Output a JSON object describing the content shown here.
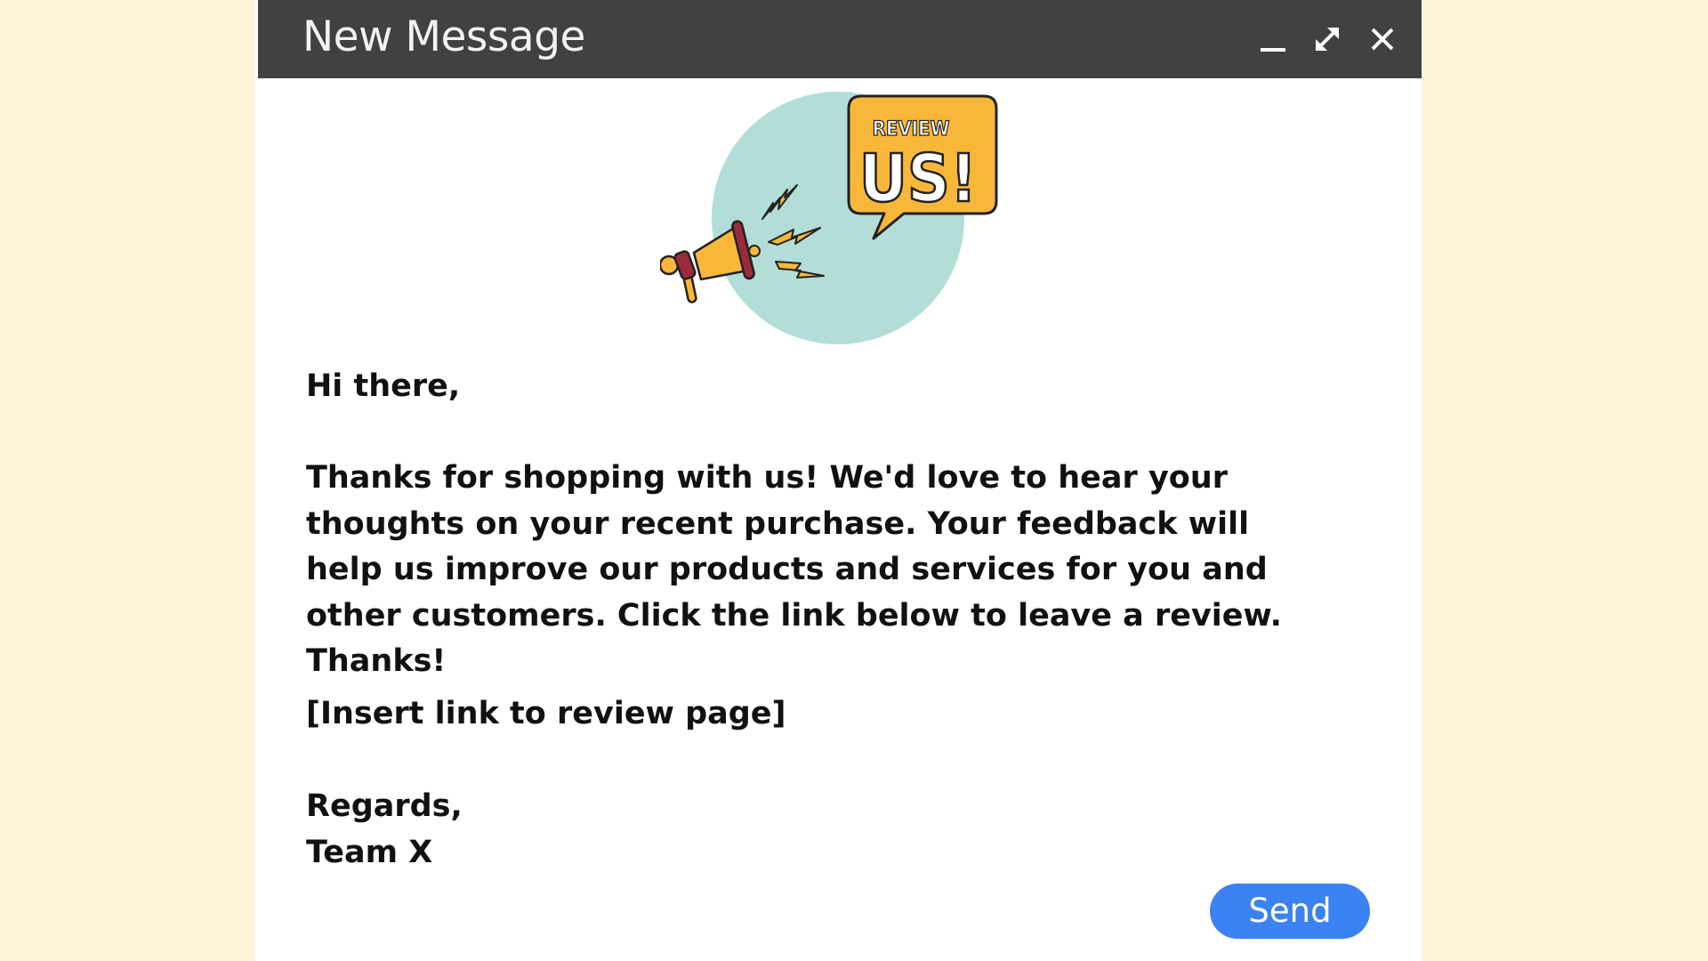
{
  "window": {
    "title": "New Message",
    "controls": {
      "minimize": "minimize-icon",
      "expand": "expand-icon",
      "close": "close-icon"
    }
  },
  "illustration": {
    "badge_small": "REVIEW",
    "badge_large": "US!"
  },
  "message": {
    "greeting": "Hi there,",
    "body": "Thanks for shopping with us! We'd love to hear your thoughts on your recent purchase. Your feedback will help us improve our products and services for you and other customers. Click the link below to leave a review. Thanks!",
    "link_placeholder": "[Insert link to review page]",
    "sign_off": "Regards,",
    "signature": "Team X"
  },
  "actions": {
    "send_label": "Send"
  },
  "colors": {
    "page_background": "#fdf4d5",
    "title_bar": "#414043",
    "send_button": "#3b82f2",
    "circle": "#b3ded8",
    "accent_yellow": "#f9b73a"
  }
}
